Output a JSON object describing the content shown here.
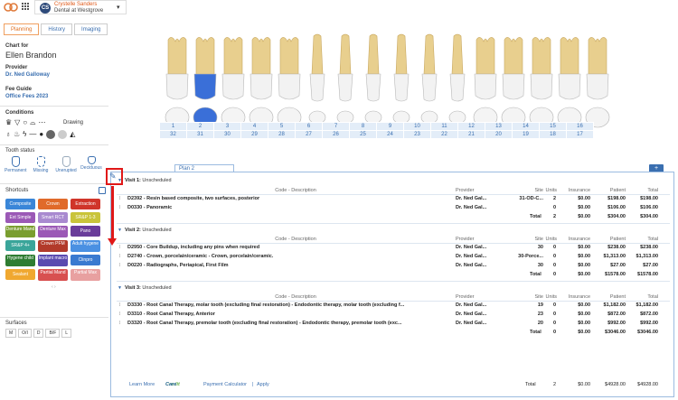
{
  "header": {
    "user_initials": "CS",
    "user_name": "Crystelle Sanders",
    "user_location": "Dental at Westgrove"
  },
  "tabs": [
    {
      "label": "Planning"
    },
    {
      "label": "History"
    },
    {
      "label": "Imaging"
    }
  ],
  "patient": {
    "chart_for_label": "Chart for",
    "name": "Ellen Brandon",
    "provider_label": "Provider",
    "provider": "Dr. Ned Galloway",
    "fee_label": "Fee Guide",
    "fee_guide": "Office Fees 2023"
  },
  "conditions": {
    "title": "Conditions",
    "drawing_label": "Drawing"
  },
  "tooth_status": {
    "title": "Tooth status",
    "items": [
      "Permanent",
      "Missing",
      "Unerupted",
      "Deciduous"
    ]
  },
  "shortcuts": {
    "title": "Shortcuts",
    "buttons": [
      {
        "label": "Composite",
        "color": "#3a86d8"
      },
      {
        "label": "Crown",
        "color": "#e06a2a"
      },
      {
        "label": "Extraction",
        "color": "#d0352a"
      },
      {
        "label": "Ext Simple",
        "color": "#9b59b6"
      },
      {
        "label": "Smart RCT",
        "color": "#a98ad0"
      },
      {
        "label": "SR&P 1-3",
        "color": "#c9c43a"
      },
      {
        "label": "Denture Mand",
        "color": "#7a9e2f"
      },
      {
        "label": "Denture Max",
        "color": "#9b59b6"
      },
      {
        "label": "Pano",
        "color": "#6a3d9a"
      },
      {
        "label": "SR&P 4+",
        "color": "#3aa59a"
      },
      {
        "label": "Crown PFM",
        "color": "#b23a2a"
      },
      {
        "label": "Adult hygene",
        "color": "#4a90e2"
      },
      {
        "label": "Hygene child",
        "color": "#2e7d32"
      },
      {
        "label": "Implant macro",
        "color": "#5a4ab0"
      },
      {
        "label": "Clinpro",
        "color": "#3a7ad0"
      },
      {
        "label": "Sealant",
        "color": "#f0a830"
      },
      {
        "label": "Partial Mand",
        "color": "#d85050"
      },
      {
        "label": "Partial Max",
        "color": "#e8a0a0"
      }
    ],
    "pager": "‹    ›"
  },
  "surfaces": {
    "title": "Surfaces",
    "items": [
      "M",
      "O/I",
      "D",
      "B/F",
      "L"
    ]
  },
  "tooth_numbers": {
    "upper": [
      "1",
      "2",
      "3",
      "4",
      "5",
      "6",
      "7",
      "8",
      "9",
      "10",
      "11",
      "12",
      "13",
      "14",
      "15",
      "16"
    ],
    "lower": [
      "32",
      "31",
      "30",
      "29",
      "28",
      "27",
      "26",
      "25",
      "24",
      "23",
      "22",
      "21",
      "20",
      "19",
      "18",
      "17"
    ]
  },
  "plan": {
    "tab_label": "Plan 2",
    "add_label": "+",
    "columns": {
      "code": "Code - Description",
      "provider": "Provider",
      "site": "Site",
      "units": "Units",
      "insurance": "Insurance",
      "patient": "Patient",
      "total": "Total"
    },
    "total_label": "Total",
    "visits": [
      {
        "title": "Visit 1:",
        "status": "Unscheduled",
        "procedures": [
          {
            "code": "D2392 - Resin based composite, two surfaces, posterior",
            "provider": "Dr. Ned Gal...",
            "site": "31-OD-C...",
            "units": "2",
            "insurance": "$0.00",
            "patient": "$198.00",
            "total": "$198.00"
          },
          {
            "code": "D0330 - Panoramic",
            "provider": "Dr. Ned Gal...",
            "site": "",
            "units": "0",
            "insurance": "$0.00",
            "patient": "$106.00",
            "total": "$106.00"
          }
        ],
        "sum": {
          "units": "2",
          "insurance": "$0.00",
          "patient": "$304.00",
          "total": "$304.00"
        }
      },
      {
        "title": "Visit 2:",
        "status": "Unscheduled",
        "procedures": [
          {
            "code": "D2950 - Core Buildup, including any pins when required",
            "provider": "Dr. Ned Gal...",
            "site": "30",
            "units": "0",
            "insurance": "$0.00",
            "patient": "$238.00",
            "total": "$238.00"
          },
          {
            "code": "D2740 - Crown, porcelain/ceramic - Crown, porcelain/ceramic.",
            "provider": "Dr. Ned Gal...",
            "site": "30-Porce...",
            "units": "0",
            "insurance": "$0.00",
            "patient": "$1,313.00",
            "total": "$1,313.00"
          },
          {
            "code": "D0220 - Radiographs, Periapical, First Film",
            "provider": "Dr. Ned Gal...",
            "site": "30",
            "units": "0",
            "insurance": "$0.00",
            "patient": "$27.00",
            "total": "$27.00"
          }
        ],
        "sum": {
          "units": "0",
          "insurance": "$0.00",
          "patient": "$1578.00",
          "total": "$1578.00"
        }
      },
      {
        "title": "Visit 3:",
        "status": "Unscheduled",
        "procedures": [
          {
            "code": "D3330 - Root Canal Therapy, molar tooth (excluding final restoration) - Endodontic therapy, molar tooth (excluding f...",
            "provider": "Dr. Ned Gal...",
            "site": "19",
            "units": "0",
            "insurance": "$0.00",
            "patient": "$1,182.00",
            "total": "$1,182.00"
          },
          {
            "code": "D3310 - Root Canal Therapy, Anterior",
            "provider": "Dr. Ned Gal...",
            "site": "23",
            "units": "0",
            "insurance": "$0.00",
            "patient": "$872.00",
            "total": "$872.00"
          },
          {
            "code": "D3320 - Root Canal Therapy, premolar tooth (excluding final restoration) - Endodontic therapy, premolar tooth (exc...",
            "provider": "Dr. Ned Gal...",
            "site": "20",
            "units": "0",
            "insurance": "$0.00",
            "patient": "$992.00",
            "total": "$992.00"
          }
        ],
        "sum": {
          "units": "0",
          "insurance": "$0.00",
          "patient": "$3046.00",
          "total": "$3046.00"
        }
      }
    ],
    "footer": {
      "learn_more": "Learn More",
      "carecredit_a": "Care",
      "carecredit_b": "Credit",
      "payment_calc": "Payment Calculator",
      "divider": "|",
      "apply": "Apply",
      "total_label": "Total",
      "units": "2",
      "insurance": "$0.00",
      "patient": "$4928.00",
      "total": "$4928.00"
    }
  },
  "colors": {
    "accent": "#3a6fb0",
    "highlight_tooth": "#3a6fd8",
    "annotation": "#e01818"
  }
}
